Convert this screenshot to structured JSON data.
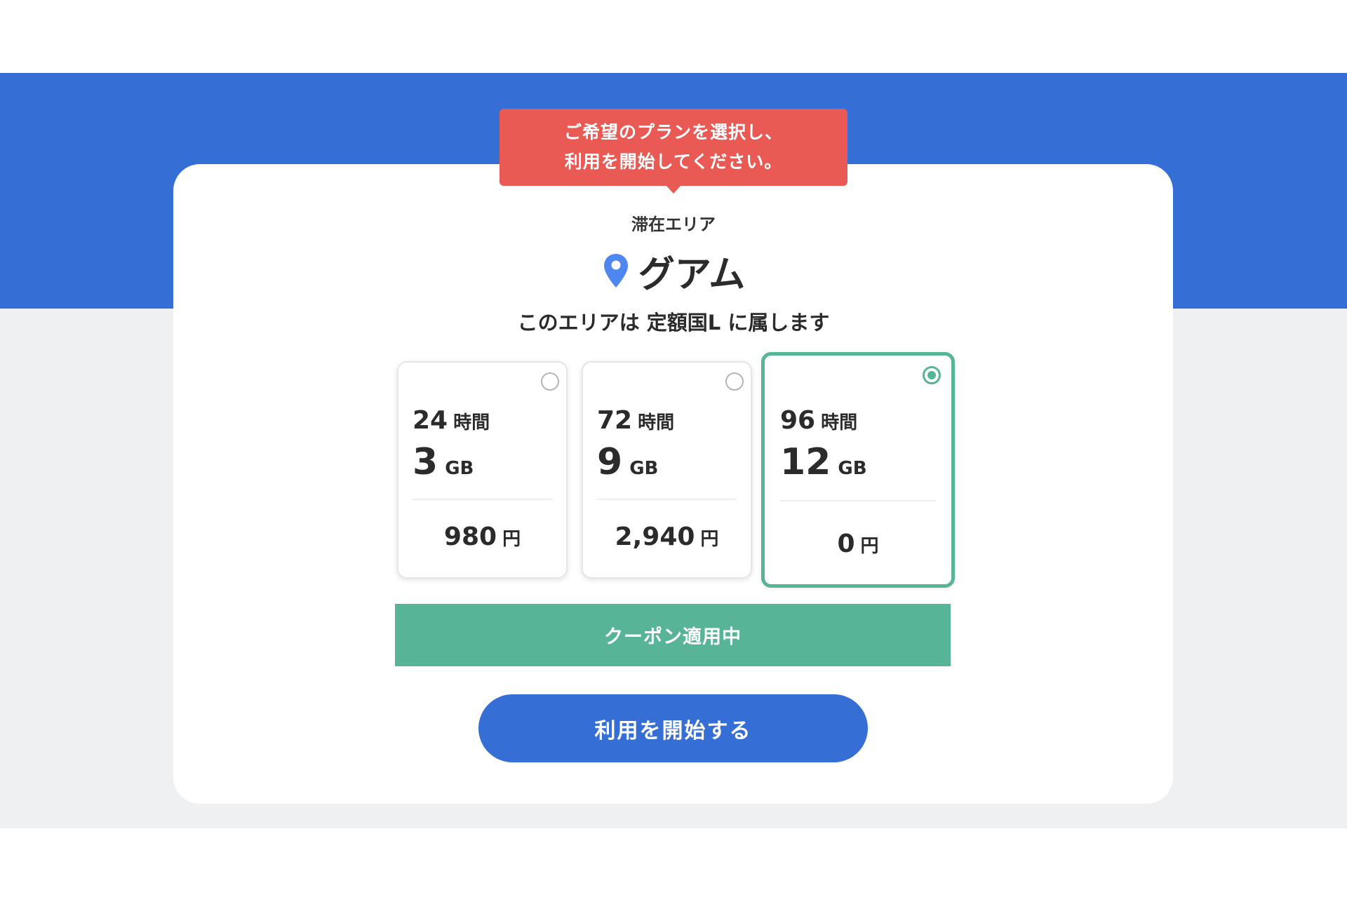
{
  "tooltip": {
    "line1": "ご希望のプランを選択し、",
    "line2": "利用を開始してください。"
  },
  "area": {
    "caption": "滞在エリア",
    "name": "グアム",
    "icon": "location-pin-icon",
    "belongs_text": "このエリアは 定額国L に属します"
  },
  "plans": [
    {
      "hours": "24",
      "hours_unit": "時間",
      "gb": "3",
      "gb_unit": "GB",
      "price": "980",
      "price_unit": "円",
      "selected": false
    },
    {
      "hours": "72",
      "hours_unit": "時間",
      "gb": "9",
      "gb_unit": "GB",
      "price": "2,940",
      "price_unit": "円",
      "selected": false
    },
    {
      "hours": "96",
      "hours_unit": "時間",
      "gb": "12",
      "gb_unit": "GB",
      "price": "0",
      "price_unit": "円",
      "selected": true
    }
  ],
  "coupon": {
    "label": "クーポン適用中"
  },
  "start_button": {
    "label": "利用を開始する"
  },
  "colors": {
    "brand_blue": "#356fd6",
    "tooltip_red": "#e95a55",
    "accent_green": "#57b497",
    "pin_blue": "#4f87f0"
  }
}
